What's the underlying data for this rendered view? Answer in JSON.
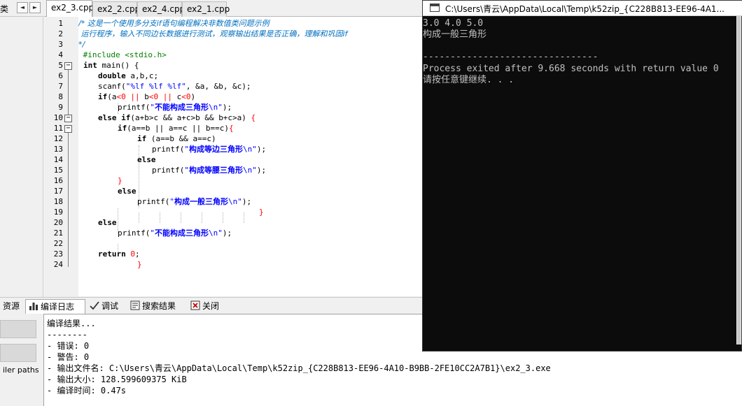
{
  "left_top": {
    "label": "类",
    "prev_arrow": "◄",
    "next_arrow": "►"
  },
  "tabs": [
    {
      "label": "ex2_3.cpp",
      "active": true
    },
    {
      "label": "ex2_2.cpp"
    },
    {
      "label": "ex2_4.cpp"
    },
    {
      "label": "ex2_1.cpp"
    }
  ],
  "editor": {
    "line_numbers": [
      "1",
      "2",
      "3",
      "4",
      "5",
      "6",
      "7",
      "8",
      "9",
      "10",
      "11",
      "12",
      "13",
      "14",
      "15",
      "16",
      "17",
      "18",
      "19",
      "20",
      "21",
      "22",
      "23",
      "24"
    ],
    "fold_markers": [
      "−",
      "−",
      "−"
    ],
    "code": {
      "l1": "/* 这是一个使用多分支if语句编程解决非数值类问题示例",
      "l2": " 运行程序，输入不同边长数据进行测试，观察输出结果是否正确，理解和巩固if",
      "l3": "*/",
      "l4": " #include <stdio.h>",
      "l5_kw": "int",
      "l5_rest": " main() {",
      "l6_kw": "double",
      "l6_rest": " a,b,c;",
      "l7_a": "scanf(",
      "l7_str": "\"%lf %lf %lf\"",
      "l7_b": ", &a, &b, &c);",
      "l8_kw": "if",
      "l8_a": "(a",
      "l8_op1": "<",
      "l8_n1": "0",
      "l8_op2": " || ",
      "l8_b": "b",
      "l8_op3": "<",
      "l8_n2": "0",
      "l8_op4": " || ",
      "l8_c": "c",
      "l8_op5": "<",
      "l8_n3": "0",
      "l8_d": ")",
      "l9_a": "printf(",
      "l9_q1": "\"",
      "l9_cjk": "不能构成三角形",
      "l9_q2": "\\n\"",
      "l9_b": ");",
      "l10_kw": "else if",
      "l10_rest": "(a+b>c && a+c>b && b+c>a) ",
      "l10_brace": "{",
      "l11_kw": "if",
      "l11_rest": "(a==b || a==c || b==c)",
      "l11_brace": "{",
      "l12_kw": "if",
      "l12_rest": " (a==b && a==c)",
      "l13_a": "printf(",
      "l13_q1": "\"",
      "l13_cjk": "构成等边三角形",
      "l13_q2": "\\n\"",
      "l13_b": ");",
      "l14_kw": "else",
      "l15_a": "printf(",
      "l15_q1": "\"",
      "l15_cjk": "构成等腰三角形",
      "l15_q2": "\\n\"",
      "l15_b": ");",
      "l16_brace": "}",
      "l17_kw": "else",
      "l18_a": "printf(",
      "l18_q1": "\"",
      "l18_cjk": "构成一般三角形",
      "l18_q2": "\\n\"",
      "l18_b": ");",
      "l19_brace": "}",
      "l20_kw": "else",
      "l21_a": "printf(",
      "l21_q1": "\"",
      "l21_cjk": "不能构成三角形",
      "l21_q2": "\\n\"",
      "l21_b": ");",
      "l23_kw": "return",
      "l23_num": " 0",
      "l23_b": ";",
      "l24_brace": "}"
    }
  },
  "bottom_tabs": [
    {
      "label": "资源"
    },
    {
      "label": "编译日志",
      "icon": "bar-chart-icon",
      "active": true
    },
    {
      "label": "调试",
      "icon": "checkmark-icon"
    },
    {
      "label": "搜索结果",
      "icon": "search-results-icon"
    },
    {
      "label": "关闭",
      "icon": "close-icon"
    }
  ],
  "bottom_left": {
    "paths_label": "iler paths"
  },
  "compile_log": [
    "编译结果...",
    "--------",
    "- 错误: 0",
    "- 警告: 0",
    "- 输出文件名: C:\\Users\\青云\\AppData\\Local\\Temp\\k52zip_{C228B813-EE96-4A10-B9BB-2FE10CC2A7B1}\\ex2_3.exe",
    "- 输出大小: 128.599609375 KiB",
    "- 编译时间: 0.47s"
  ],
  "console": {
    "title": "C:\\Users\\青云\\AppData\\Local\\Temp\\k52zip_{C228B813-EE96-4A1...",
    "lines": [
      "3.0 4.0 5.0",
      "构成一般三角形",
      "",
      "--------------------------------",
      "Process exited after 9.668 seconds with return value 0",
      "请按任意键继续. . ."
    ]
  },
  "colors": {
    "comment": "#0070c0",
    "preprocessor": "#008000",
    "string": "#0000ff",
    "number": "#ff0000",
    "console_bg": "#0c0c0c",
    "console_fg": "#c0c0c0"
  }
}
